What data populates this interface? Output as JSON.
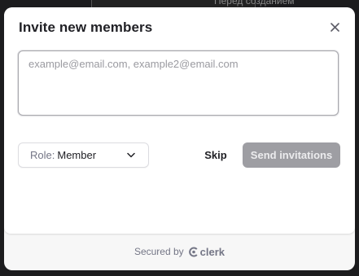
{
  "background": {
    "partial_text": "Перед созданием"
  },
  "modal": {
    "title": "Invite new members",
    "close_icon": "close-icon"
  },
  "email_input": {
    "value": "",
    "placeholder": "example@email.com, example2@email.com"
  },
  "role_select": {
    "prefix": "Role:",
    "value": "Member",
    "icon": "chevron-down-icon"
  },
  "actions": {
    "skip_label": "Skip",
    "send_label": "Send invitations",
    "send_disabled": true
  },
  "footer": {
    "secured_by": "Secured by",
    "brand": "clerk",
    "brand_icon": "clerk-logo-icon"
  },
  "colors": {
    "primary_disabled": "#9e9ea3",
    "text": "#212126",
    "muted": "#747686",
    "backdrop": "#1c1c1e"
  }
}
